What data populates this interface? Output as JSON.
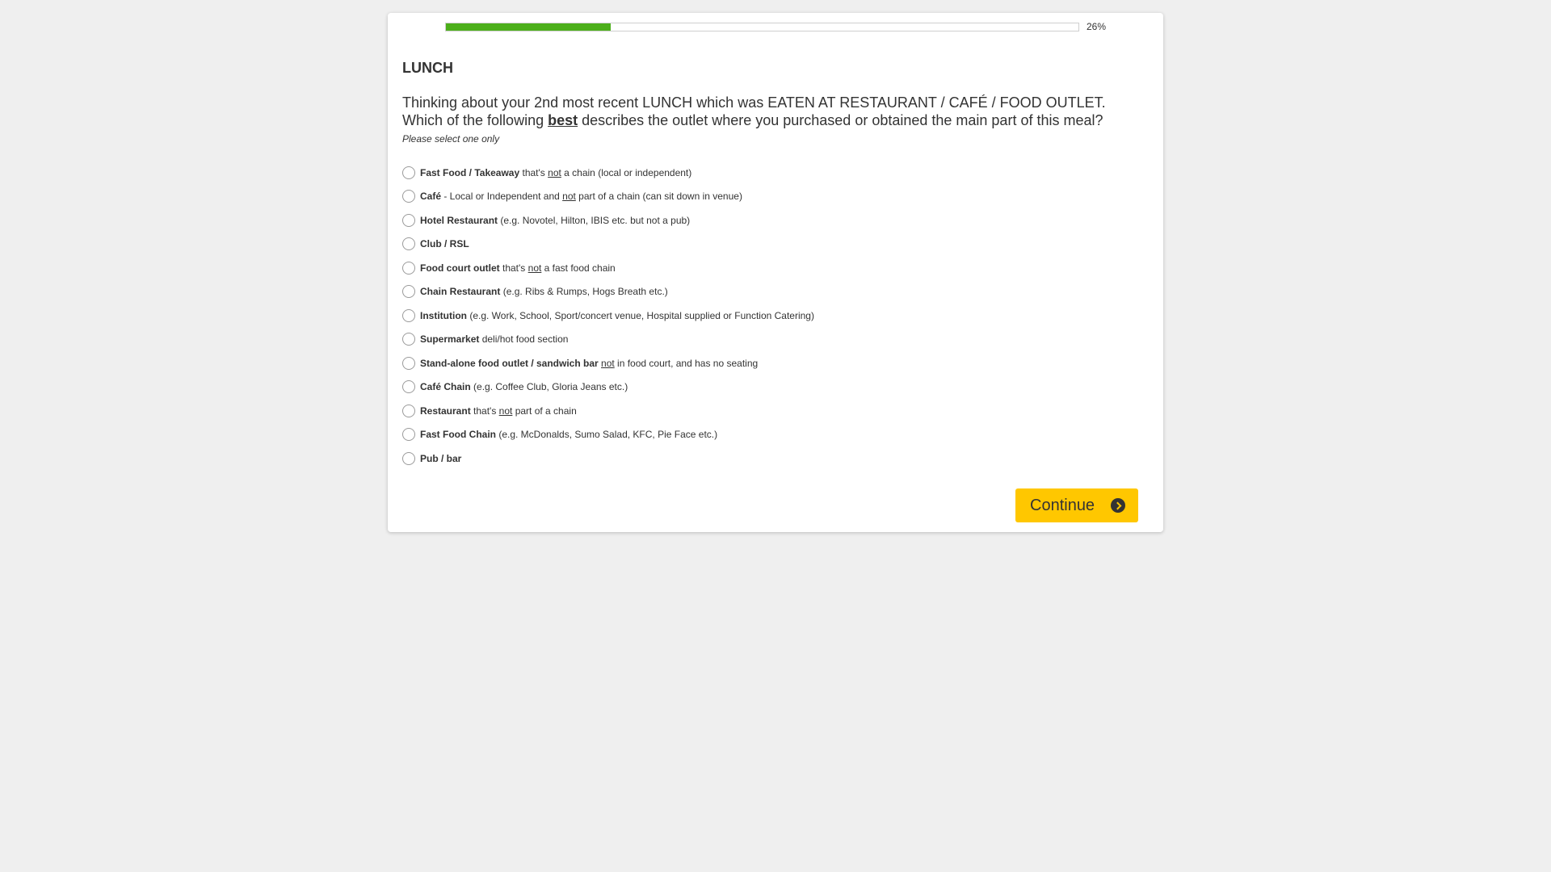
{
  "progress": {
    "percent": 26,
    "label": "26%",
    "fill_color": "#4caf1a"
  },
  "section_title": "LUNCH",
  "question": {
    "line1": "Thinking about your 2nd most recent LUNCH which was EATEN AT RESTAURANT / CAFÉ / FOOD OUTLET.",
    "line2_pre": "Which of the following ",
    "line2_emph": "best",
    "line2_post": " describes the outlet where you purchased or obtained the main part of this meal?"
  },
  "instruction": "Please select one only",
  "options": [
    {
      "bold": "Fast Food / Takeaway",
      "pre": " that's ",
      "u": "not",
      "post": " a chain (local or independent)"
    },
    {
      "bold": "Café",
      "pre": " - Local or Independent and ",
      "u": "not",
      "post": " part of a chain (can sit down in venue)"
    },
    {
      "bold": "Hotel Restaurant",
      "pre": " (e.g. Novotel, Hilton, IBIS etc. but not a pub)",
      "u": "",
      "post": ""
    },
    {
      "bold": "Club / RSL",
      "pre": "",
      "u": "",
      "post": ""
    },
    {
      "bold": "Food court outlet",
      "pre": " that's ",
      "u": "not",
      "post": " a fast food chain"
    },
    {
      "bold": "Chain Restaurant",
      "pre": " (e.g. Ribs & Rumps, Hogs Breath etc.)",
      "u": "",
      "post": ""
    },
    {
      "bold": "Institution",
      "pre": " (e.g. Work, School, Sport/concert venue, Hospital supplied or Function Catering)",
      "u": "",
      "post": ""
    },
    {
      "bold": "Supermarket",
      "pre": " deli/hot food section",
      "u": "",
      "post": ""
    },
    {
      "bold": "Stand-alone food outlet / sandwich bar",
      "pre": " ",
      "u": "not",
      "post": " in food court, and has no seating"
    },
    {
      "bold": "Café Chain",
      "pre": " (e.g. Coffee Club, Gloria Jeans etc.)",
      "u": "",
      "post": ""
    },
    {
      "bold": "Restaurant",
      "pre": " that's ",
      "u": "not",
      "post": " part of a chain"
    },
    {
      "bold": "Fast Food Chain",
      "pre": " (e.g. McDonalds, Sumo Salad, KFC, Pie Face etc.)",
      "u": "",
      "post": ""
    },
    {
      "bold": "Pub / bar",
      "pre": "",
      "u": "",
      "post": ""
    }
  ],
  "continue_button": {
    "label": "Continue",
    "icon": "arrow-circle-right-icon",
    "color": "#ffc700"
  }
}
